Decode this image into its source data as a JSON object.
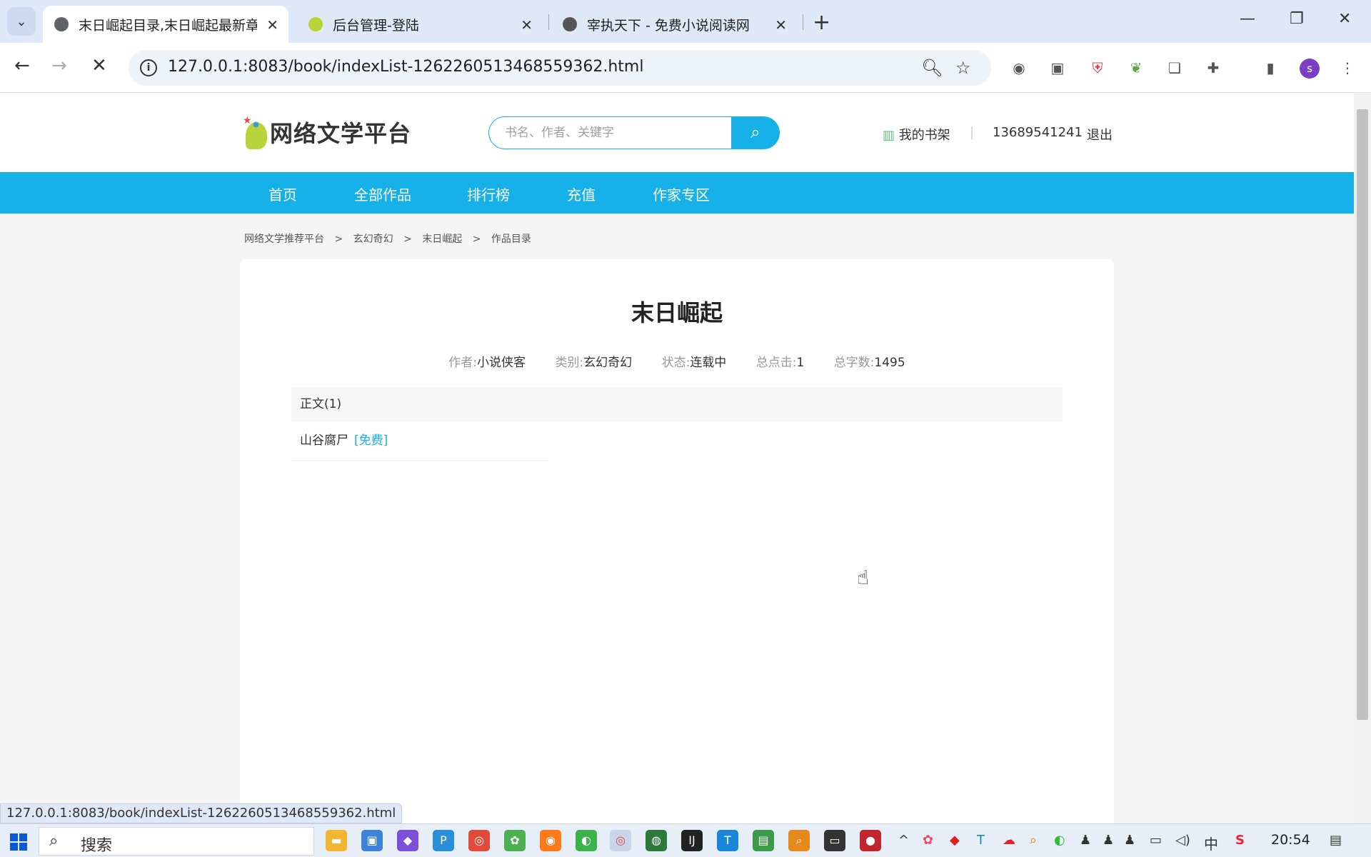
{
  "browser": {
    "tabs": [
      {
        "title": "末日崛起目录,末日崛起最新章节",
        "active": true
      },
      {
        "title": "后台管理-登陆",
        "active": false
      },
      {
        "title": "宰执天下 - 免费小说阅读网",
        "active": false
      }
    ],
    "url": "127.0.0.1:8083/book/indexList-1262260513468559362.html",
    "status_url": "127.0.0.1:8083/book/indexList-1262260513468559362.html",
    "profile_initial": "s"
  },
  "site": {
    "logo_text": "网络文学平台",
    "search_placeholder": "书名、作者、关键字",
    "bookshelf": "我的书架",
    "separator": "|",
    "username": "13689541241",
    "logout": "退出",
    "nav": [
      "首页",
      "全部作品",
      "排行榜",
      "充值",
      "作家专区"
    ]
  },
  "breadcrumb": [
    "网络文学推荐平台",
    ">",
    "玄幻奇幻",
    ">",
    "末日崛起",
    ">",
    "作品目录"
  ],
  "book": {
    "title": "末日崛起",
    "meta": {
      "author_label": "作者:",
      "author": "小说侠客",
      "category_label": "类别:",
      "category": "玄幻奇幻",
      "status_label": "状态:",
      "status": "连载中",
      "clicks_label": "总点击:",
      "clicks": "1",
      "words_label": "总字数:",
      "words": "1495"
    },
    "volume": "正文(1)",
    "chapters": [
      {
        "name": "山谷腐尸",
        "tag": "[免费]"
      }
    ]
  },
  "taskbar": {
    "search_label": "搜索",
    "ime": "中",
    "time": "20:54"
  },
  "colors": {
    "accent": "#16b1e8",
    "tabstrip": "#dfe8f7"
  }
}
